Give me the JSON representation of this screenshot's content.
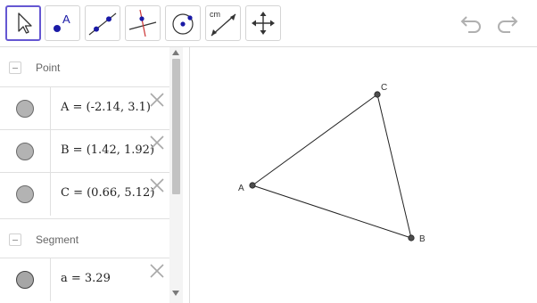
{
  "toolbar": {
    "tools": [
      {
        "name": "move-tool",
        "icon": "cursor-arrow-icon",
        "active": true
      },
      {
        "name": "point-tool",
        "icon": "point-A-icon",
        "label": "A"
      },
      {
        "name": "line-tool",
        "icon": "line-through-points-icon"
      },
      {
        "name": "perpendicular-tool",
        "icon": "perpendicular-line-icon"
      },
      {
        "name": "circle-tool",
        "icon": "circle-center-point-icon"
      },
      {
        "name": "measure-tool",
        "icon": "distance-measure-icon",
        "label": "cm"
      },
      {
        "name": "move-view-tool",
        "icon": "move-arrows-icon"
      }
    ],
    "undo_icon": "undo-icon",
    "redo_icon": "redo-icon"
  },
  "algebra": {
    "groups": [
      {
        "label": "Point"
      },
      {
        "label": "Segment"
      }
    ],
    "rows": [
      {
        "definition": "A = (-2.14, 3.1)"
      },
      {
        "definition": "B = (1.42, 1.92)"
      },
      {
        "definition": "C = (0.66, 5.12)"
      },
      {
        "definition": "a = 3.29"
      }
    ]
  },
  "graphics": {
    "points": [
      {
        "label": "A"
      },
      {
        "label": "B"
      },
      {
        "label": "C"
      }
    ]
  },
  "colors": {
    "active_tool_border": "#6557d2",
    "point_fill": "#4d4d4d",
    "marble_fill": "#b3b3b3",
    "icon_blue": "#1a1aa6",
    "icon_red": "#cc3333"
  }
}
